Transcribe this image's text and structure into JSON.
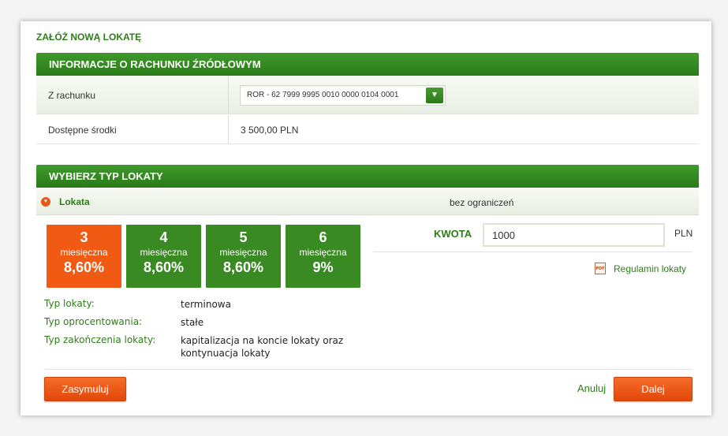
{
  "dialog": {
    "title": "ZAŁÓŻ NOWĄ LOKATĘ"
  },
  "source_account": {
    "header": "INFORMACJE O RACHUNKU ŹRÓDŁOWYM",
    "account_label": "Z rachunku",
    "account_value": "ROR - 62 7999 9995 0010 0000 0104 0001",
    "available_label": "Dostępne środki",
    "available_value": "3 500,00 PLN"
  },
  "deposit_type": {
    "header": "WYBIERZ TYP LOKATY",
    "subheader_label": "Lokata",
    "subheader_note": "bez ograniczeń",
    "tiles": [
      {
        "number": "3",
        "unit": "miesięczna",
        "rate": "8,60%",
        "selected": true
      },
      {
        "number": "4",
        "unit": "miesięczna",
        "rate": "8,60%",
        "selected": false
      },
      {
        "number": "5",
        "unit": "miesięczna",
        "rate": "8,60%",
        "selected": false
      },
      {
        "number": "6",
        "unit": "miesięczna",
        "rate": "9%",
        "selected": false
      }
    ],
    "amount_label": "KWOTA",
    "amount_value": "1000",
    "currency": "PLN",
    "terms_icon": "pdf-icon",
    "terms_link": "Regulamin lokaty",
    "details": [
      {
        "label": "Typ lokaty:",
        "value": "terminowa"
      },
      {
        "label": "Typ oprocentowania:",
        "value": "stałe"
      },
      {
        "label": "Typ zakończenia lokaty:",
        "value": "kapitalizacja na koncie lokaty oraz kontynuacja lokaty"
      }
    ]
  },
  "footer": {
    "simulate_label": "Zasymuluj",
    "cancel_label": "Anuluj",
    "next_label": "Dalej"
  },
  "colors": {
    "green": "#2e7d1a",
    "tile_green": "#3a8a23",
    "orange": "#f05a12"
  }
}
